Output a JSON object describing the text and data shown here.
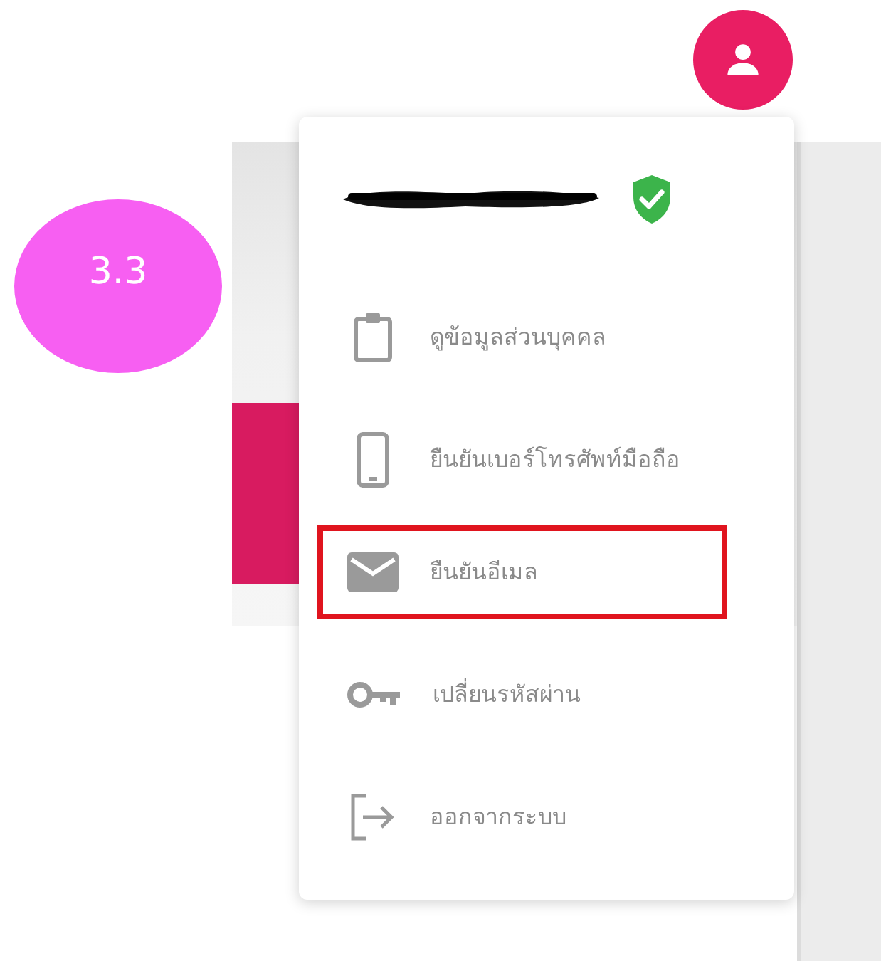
{
  "annotation": {
    "label": "3.3"
  },
  "account_menu": {
    "user": {
      "verified": true
    },
    "items": [
      {
        "kind": "clipboard",
        "label": "ดูข้อมูลส่วนบุคคล",
        "highlighted": false
      },
      {
        "kind": "phone",
        "label": "ยืนยันเบอร์โทรศัพท์มือถือ",
        "highlighted": false
      },
      {
        "kind": "mail",
        "label": "ยืนยันอีเมล",
        "highlighted": true
      },
      {
        "kind": "key",
        "label": "เปลี่ยนรหัสผ่าน",
        "highlighted": false
      },
      {
        "kind": "logout",
        "label": "ออกจากระบบ",
        "highlighted": false
      }
    ]
  }
}
